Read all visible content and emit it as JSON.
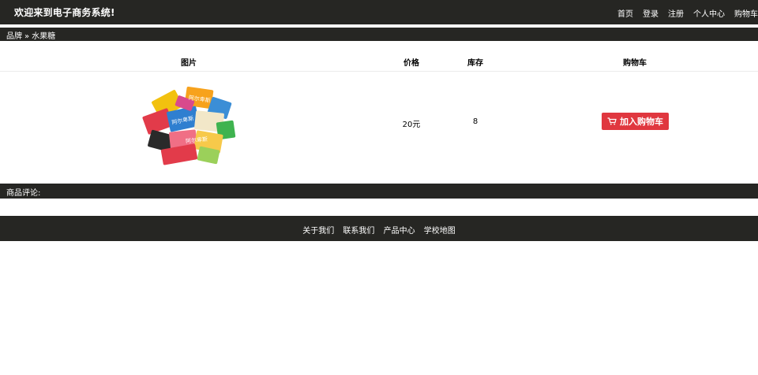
{
  "header": {
    "title": "欢迎来到电子商务系统!",
    "nav": [
      "首页",
      "登录",
      "注册",
      "个人中心",
      "购物车"
    ]
  },
  "breadcrumb": {
    "parent": "品牌",
    "separator": "»",
    "current": "水果糖"
  },
  "table": {
    "headers": {
      "image": "图片",
      "price": "价格",
      "stock": "库存",
      "cart": "购物车"
    },
    "row": {
      "price": "20元",
      "stock": "8",
      "add_to_cart_label": "加入购物车",
      "image_icon": "fruit-candy-product-image"
    }
  },
  "reviews": {
    "label": "商品评论:"
  },
  "footer": {
    "links": [
      "关于我们",
      "联系我们",
      "产品中心",
      "学校地图"
    ]
  },
  "colors": {
    "bar_background": "#262623",
    "button_red": "#e0373f",
    "text_light": "#ffffff"
  }
}
